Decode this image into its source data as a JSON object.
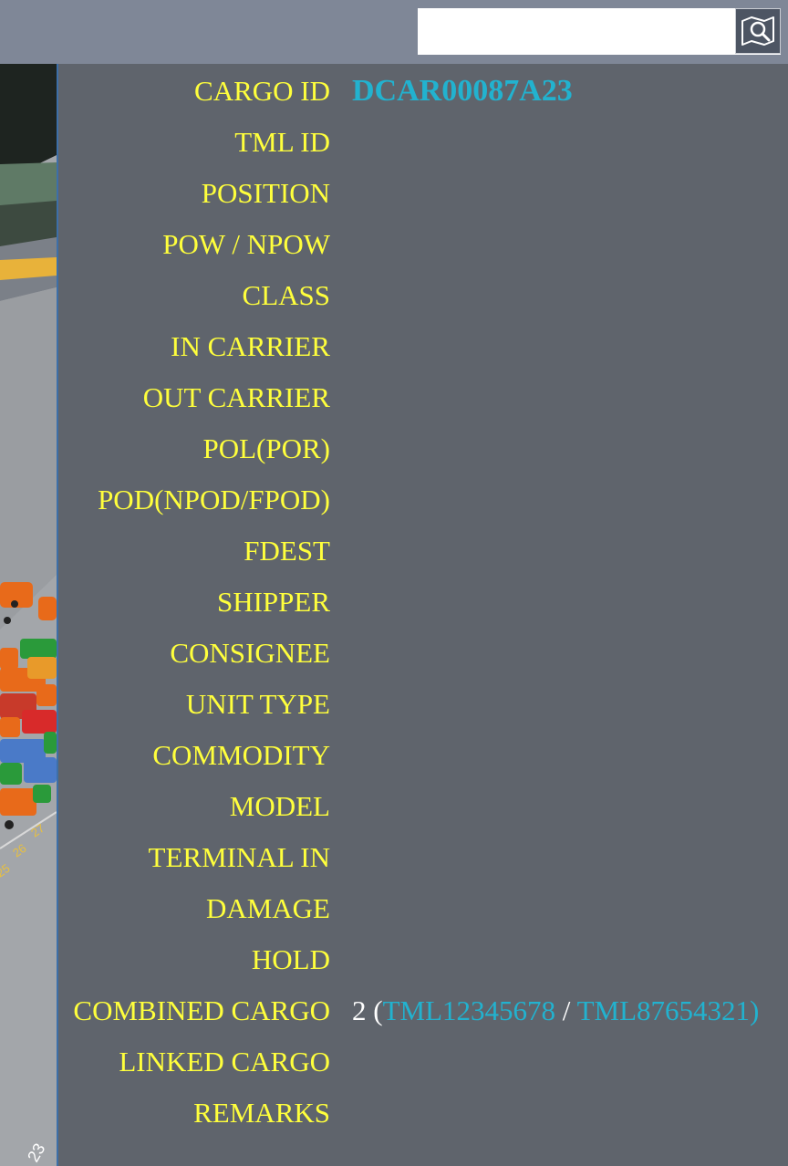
{
  "search": {
    "value": "",
    "placeholder": "",
    "button_icon": "map-search-icon"
  },
  "scene": {
    "yard_numbers": [
      "27",
      "26",
      "25",
      "23"
    ]
  },
  "fields": [
    {
      "label": "CARGO ID",
      "value": "DCAR00087A23"
    },
    {
      "label": "TML ID",
      "value": ""
    },
    {
      "label": "POSITION",
      "value": ""
    },
    {
      "label": "POW / NPOW",
      "value": ""
    },
    {
      "label": "CLASS",
      "value": ""
    },
    {
      "label": "IN CARRIER",
      "value": ""
    },
    {
      "label": "OUT CARRIER",
      "value": ""
    },
    {
      "label": "POL(POR)",
      "value": ""
    },
    {
      "label": "POD(NPOD/FPOD)",
      "value": ""
    },
    {
      "label": "FDEST",
      "value": ""
    },
    {
      "label": "SHIPPER",
      "value": ""
    },
    {
      "label": "CONSIGNEE",
      "value": ""
    },
    {
      "label": "UNIT TYPE",
      "value": ""
    },
    {
      "label": "COMMODITY",
      "value": ""
    },
    {
      "label": "MODEL",
      "value": ""
    },
    {
      "label": "TERMINAL IN",
      "value": ""
    },
    {
      "label": "DAMAGE",
      "value": ""
    },
    {
      "label": "HOLD",
      "value": ""
    },
    {
      "label": "COMBINED CARGO",
      "value": ""
    },
    {
      "label": "LINKED CARGO",
      "value": ""
    },
    {
      "label": "REMARKS",
      "value": ""
    }
  ],
  "combined_cargo": {
    "count": "2",
    "open": "(",
    "link1": "TML12345678",
    "sep": "/",
    "link2": "TML87654321)"
  },
  "colors": {
    "label": "#ffff3c",
    "link": "#22b2cf",
    "panel": "#5f646c",
    "topbar": "#7f8797"
  }
}
